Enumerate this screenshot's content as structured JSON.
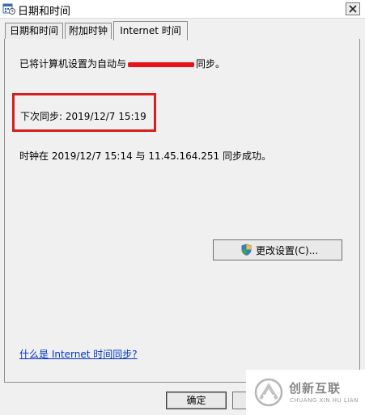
{
  "window": {
    "title": "日期和时间"
  },
  "tabs": [
    {
      "label": "日期和时间"
    },
    {
      "label": "附加时钟"
    },
    {
      "label": "Internet 时间"
    }
  ],
  "content": {
    "sync_prefix": "已将计算机设置为自动与",
    "sync_suffix": "同步。",
    "next_sync": "下次同步: 2019/12/7 15:19",
    "last_sync": "时钟在 2019/12/7 15:14 与 11.45.164.251 同步成功。",
    "change_settings_label": "更改设置(C)...",
    "help_link": "什么是 Internet 时间同步?"
  },
  "footer": {
    "ok_label": "确定",
    "cancel_label": ""
  },
  "watermark": {
    "cn": "创新互联",
    "en": "CHUANG XIN HU LIAN"
  },
  "colors": {
    "highlight": "#d62020",
    "link": "#0033cc",
    "redaction": "#e4141a"
  },
  "icons": {
    "title": "calendar-clock-icon",
    "close": "close-icon",
    "settings": "shield-icon"
  }
}
